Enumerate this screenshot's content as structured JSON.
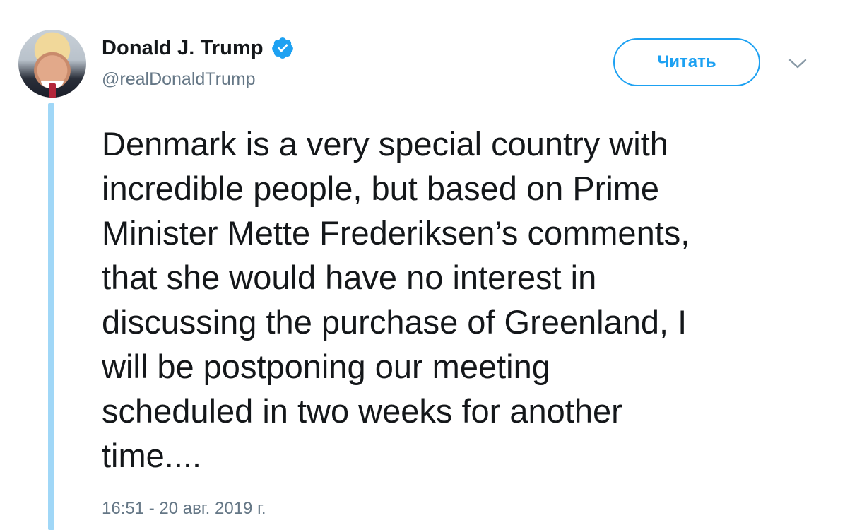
{
  "author": {
    "name": "Donald J. Trump",
    "handle": "@realDonaldTrump",
    "verified_icon": "verified-badge-icon"
  },
  "follow_button": {
    "label": "Читать"
  },
  "menu": {
    "icon": "chevron-down-icon"
  },
  "tweet": {
    "lines": [
      "Denmark is a very special country with",
      "incredible people, but based on Prime",
      "Minister Mette Frederiksen’s comments,",
      "that she would have no interest in",
      "discussing the purchase of Greenland, I",
      "will be postponing our meeting",
      "scheduled in two weeks for another",
      "time...."
    ],
    "timestamp": "16:51 - 20 авг. 2019 г."
  },
  "colors": {
    "accent": "#1da1f2",
    "thread_line": "#a0d7f7",
    "text": "#14171a",
    "secondary": "#657786"
  }
}
